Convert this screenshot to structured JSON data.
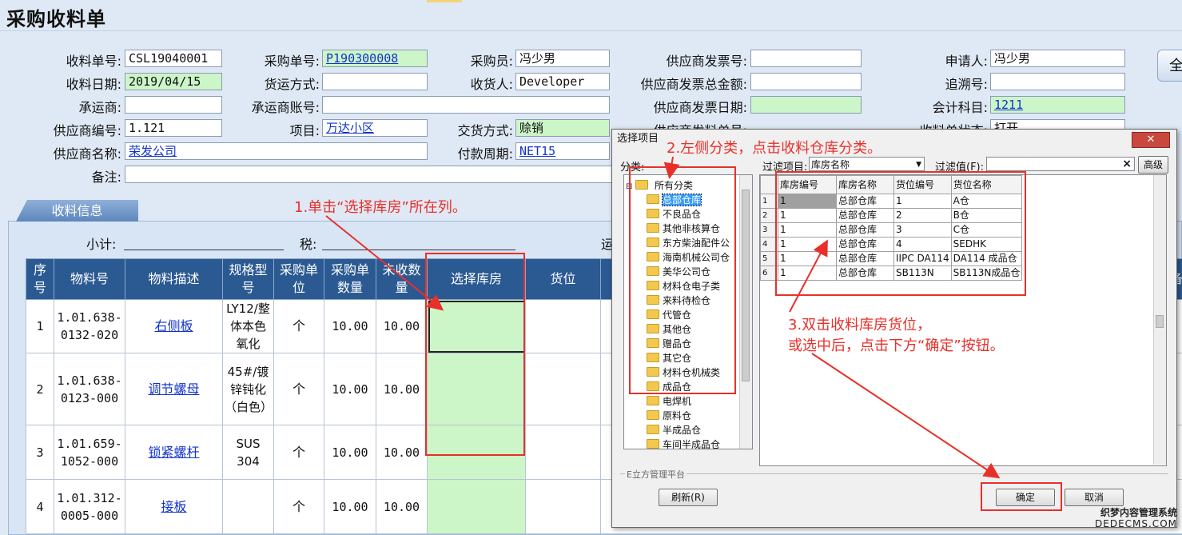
{
  "page_title": "采购收料单",
  "right_button_glyph": "全",
  "form": {
    "receipt_no_label": "收料单号:",
    "receipt_no": "CSL19040001",
    "po_no_label": "采购单号:",
    "po_no": "P190300008",
    "buyer_label": "采购员:",
    "buyer": "冯少男",
    "supplier_invoice_no_label": "供应商发票号:",
    "supplier_invoice_no": "",
    "applicant_label": "申请人:",
    "applicant": "冯少男",
    "receipt_date_label": "收料日期:",
    "receipt_date": "2019/04/15",
    "shipping_method_label": "货运方式:",
    "shipping_method": "",
    "receiver_label": "收货人:",
    "receiver": "Developer",
    "supplier_invoice_total_label": "供应商发票总金额:",
    "supplier_invoice_total": "",
    "trace_no_label": "追溯号:",
    "trace_no": "",
    "carrier_label": "承运商:",
    "carrier": "",
    "carrier_account_label": "承运商账号:",
    "carrier_account": "",
    "supplier_invoice_date_label": "供应商发票日期:",
    "supplier_invoice_date": "",
    "account_subject_label": "会计科目:",
    "account_subject": "1211",
    "supplier_code_label": "供应商编号:",
    "supplier_code": "1.121",
    "project_label": "项目:",
    "project": "万达小区",
    "delivery_method_label": "交货方式:",
    "delivery_method": "赊销",
    "supplier_ship_no_label": "供应商发料单号:",
    "receipt_status_label": "收料单状态:",
    "receipt_status": "打开",
    "supplier_name_label": "供应商名称:",
    "supplier_name": "荣发公司",
    "payment_term_label": "付款周期:",
    "payment_term": "NET15",
    "remark_label": "备注:",
    "remark": ""
  },
  "tab": {
    "label": "收料信息"
  },
  "subtotal": {
    "subtotal_label": "小计:",
    "tax_label": "税:",
    "freight_label": "运"
  },
  "table": {
    "headers": [
      "序号",
      "物料号",
      "物料描述",
      "规格型号",
      "采购单位",
      "采购单数量",
      "未收数量",
      "选择库房",
      "货位",
      "备"
    ],
    "rows": [
      {
        "no": "1",
        "code": "1.01.638-0132-020",
        "desc": "右侧板",
        "spec": "LY12/整体本色氧化",
        "unit": "个",
        "qty": "10.00",
        "unrecv": "10.00"
      },
      {
        "no": "2",
        "code": "1.01.638-0123-000",
        "desc": "调节螺母",
        "spec": "45#/镀锌钝化（白色）",
        "unit": "个",
        "qty": "10.00",
        "unrecv": "10.00"
      },
      {
        "no": "3",
        "code": "1.01.659-1052-000",
        "desc": "锁紧螺杆",
        "spec": "SUS 304",
        "unit": "个",
        "qty": "10.00",
        "unrecv": "10.00"
      },
      {
        "no": "4",
        "code": "1.01.312-0005-000",
        "desc": "接板",
        "spec": "",
        "unit": "个",
        "qty": "10.00",
        "unrecv": "10.00"
      }
    ]
  },
  "annotations": {
    "step1": "1.单击“选择库房”所在列。",
    "step2": "2.左侧分类，点击收料仓库分类。",
    "step3_line1": "3.双击收料库房货位，",
    "step3_line2": "或选中后，点击下方“确定”按钮。"
  },
  "dialog": {
    "title": "选择项目",
    "close_glyph": "✕",
    "category_label": "分类:",
    "filter_item_label": "过滤项目:",
    "filter_item_value": "库房名称",
    "filter_value_label": "过滤值(F):",
    "filter_value": "",
    "clear_glyph": "×",
    "advanced_button": "高级",
    "tree_root": "所有分类",
    "tree_items": [
      "总部仓库",
      "不良品仓",
      "其他非核算仓",
      "东方柴油配件公",
      "海南机械公司仓",
      "美华公司仓",
      "材料仓电子类",
      "来料待检仓",
      "代管仓",
      "其他仓",
      "赠品仓",
      "其它仓",
      "材料仓机械类",
      "成品仓",
      "电焊机",
      "原料仓",
      "半成品仓",
      "车间半成品仓"
    ],
    "list_headers": [
      "库房编号",
      "库房名称",
      "货位编号",
      "货位名称"
    ],
    "list_rows": [
      {
        "code": "1",
        "name": "总部仓库",
        "loc_code": "1",
        "loc_name": "A仓"
      },
      {
        "code": "1",
        "name": "总部仓库",
        "loc_code": "2",
        "loc_name": "B仓"
      },
      {
        "code": "1",
        "name": "总部仓库",
        "loc_code": "3",
        "loc_name": "C仓"
      },
      {
        "code": "1",
        "name": "总部仓库",
        "loc_code": "4",
        "loc_name": "SEDHK"
      },
      {
        "code": "1",
        "name": "总部仓库",
        "loc_code": "IIPC DA114",
        "loc_name": "DA114 成品仓"
      },
      {
        "code": "1",
        "name": "总部仓库",
        "loc_code": "SB113N",
        "loc_name": "SB113N成品仓"
      }
    ],
    "row_numbers": [
      "1",
      "2",
      "3",
      "4",
      "5",
      "6"
    ],
    "footer_group": "E立方管理平台",
    "refresh_button": "刷新(R)",
    "ok_button": "确定",
    "cancel_button": "取消"
  },
  "watermark": {
    "line1": "织梦内容管理系统",
    "line2": "DEDECMS.COM"
  }
}
